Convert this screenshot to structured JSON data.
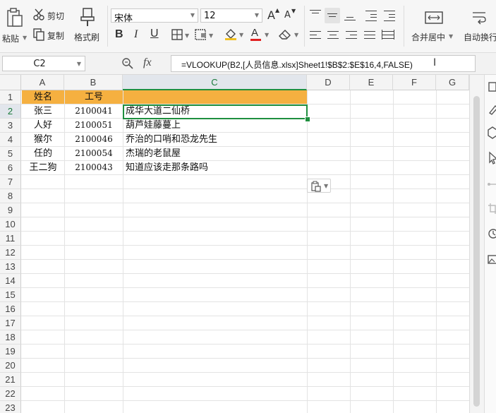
{
  "toolbar": {
    "paste": "粘贴",
    "cut": "剪切",
    "copy": "复制",
    "format_painter": "格式刷",
    "font_name": "宋体",
    "font_size": "12",
    "bold": "B",
    "italic": "I",
    "underline": "U",
    "grow_font": "A",
    "shrink_font": "A",
    "font_color": "A",
    "merge_center": "合并居中",
    "wrap_text": "自动换行"
  },
  "formula_bar": {
    "name_box": "C2",
    "fx": "fx",
    "formula": "=VLOOKUP(B2,[人员信息.xlsx]Sheet1!$B$2:$E$16,4,FALSE)"
  },
  "columns": [
    "A",
    "B",
    "C",
    "D",
    "E",
    "F",
    "G"
  ],
  "rows": [
    "1",
    "2",
    "3",
    "4",
    "5",
    "6",
    "7",
    "8",
    "9",
    "10",
    "11",
    "12",
    "13",
    "14",
    "15",
    "16",
    "17",
    "18",
    "19",
    "20",
    "21",
    "22",
    "23"
  ],
  "table": {
    "headers": [
      "姓名",
      "工号"
    ],
    "data": [
      {
        "name": "张三",
        "id": "2100041",
        "c": "成华大道二仙桥"
      },
      {
        "name": "人好",
        "id": "2100051",
        "c": "葫芦娃藤蔓上"
      },
      {
        "name": "猴尔",
        "id": "2100046",
        "c": "乔治的口哨和恐龙先生"
      },
      {
        "name": "任的",
        "id": "2100054",
        "c": "杰瑞的老鼠屋"
      },
      {
        "name": "王二狗",
        "id": "2100043",
        "c": "知道应该走那条路吗"
      }
    ]
  },
  "colors": {
    "header_fill": "#f5b040",
    "selection": "#1f8f3f",
    "font_color_bar": "#e02020",
    "fill_color_bar": "#f0c020"
  }
}
